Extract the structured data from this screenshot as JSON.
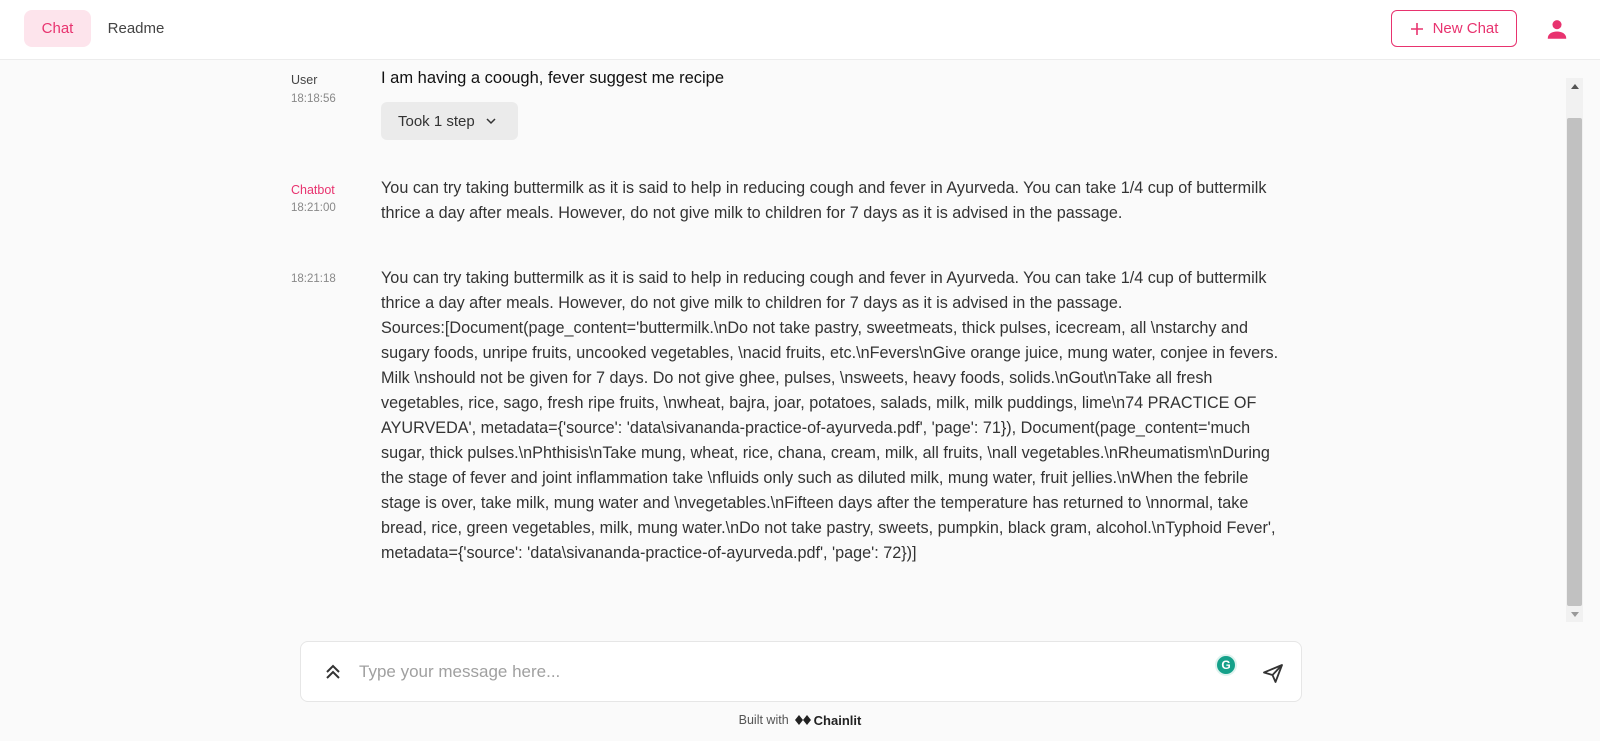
{
  "header": {
    "tabs": [
      {
        "label": "Chat"
      },
      {
        "label": "Readme"
      }
    ],
    "new_chat_label": "New Chat"
  },
  "colors": {
    "accent": "#e8336f",
    "background": "#fafafa"
  },
  "messages": [
    {
      "author": "User",
      "time": "18:18:56",
      "text": "I am having a coough, fever suggest me recipe",
      "step_label": "Took 1 step"
    },
    {
      "author": "Chatbot",
      "time": "18:21:00",
      "text": "You can try taking buttermilk as it is said to help in reducing cough and fever in Ayurveda. You can take 1/4 cup of buttermilk thrice a day after meals. However, do not give milk to children for 7 days as it is advised in the passage."
    },
    {
      "author": "",
      "time": "18:21:18",
      "text": "You can try taking buttermilk as it is said to help in reducing cough and fever in Ayurveda. You can take 1/4 cup of buttermilk thrice a day after meals. However, do not give milk to children for 7 days as it is advised in the passage.\nSources:[Document(page_content='buttermilk.\\nDo not take pastry, sweetmeats, thick pulses, icecream, all \\nstarchy and sugary foods, unripe fruits, uncooked vegetables, \\nacid fruits, etc.\\nFevers\\nGive orange juice, mung water, conjee in fevers. Milk \\nshould not be given for 7 days. Do not give ghee, pulses, \\nsweets, heavy foods, solids.\\nGout\\nTake all fresh vegetables, rice, sago, fresh ripe fruits, \\nwheat, bajra, joar, potatoes, salads, milk, milk puddings, lime\\n74 PRACTICE OF AYURVEDA', metadata={'source': 'data\\sivananda-practice-of-ayurveda.pdf', 'page': 71}), Document(page_content='much sugar, thick pulses.\\nPhthisis\\nTake mung, wheat, rice, chana, cream, milk, all fruits, \\nall vegetables.\\nRheumatism\\nDuring the stage of fever and joint inflammation take \\nfluids only such as diluted milk, mung water, fruit jellies.\\nWhen the febrile stage is over, take milk, mung water and \\nvegetables.\\nFifteen days after the temperature has returned to \\nnormal, take bread, rice, green vegetables, milk, mung water.\\nDo not take pastry, sweets, pumpkin, black gram, alcohol.\\nTyphoid Fever', metadata={'source': 'data\\sivananda-practice-of-ayurveda.pdf', 'page': 72})]"
    }
  ],
  "composer": {
    "placeholder": "Type your message here..."
  },
  "footer": {
    "built_with": "Built with",
    "brand": "Chainlit"
  }
}
